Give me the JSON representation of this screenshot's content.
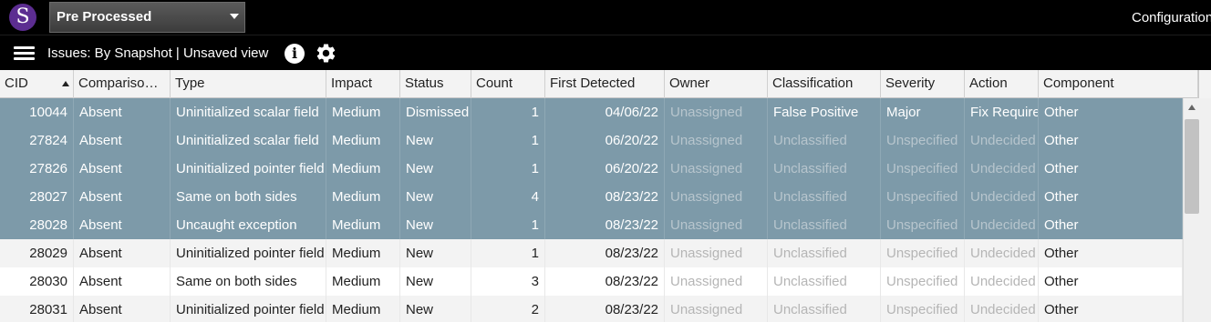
{
  "app": {
    "logo_letter": "S",
    "project": "Pre Processed",
    "configuration_label": "Configuration"
  },
  "viewbar": {
    "title": "Issues: By Snapshot | Unsaved view",
    "info_glyph": "i",
    "icons": [
      "menu-icon",
      "info-icon",
      "gear-icon"
    ]
  },
  "colors": {
    "selected_row": "#7d9aa9",
    "logo": "#5c2d91",
    "dim_text": "#b5b5b5"
  },
  "columns": [
    "CID",
    "Compariso…",
    "Type",
    "Impact",
    "Status",
    "Count",
    "First Detected",
    "Owner",
    "Classification",
    "Severity",
    "Action",
    "Component"
  ],
  "sort": {
    "column": "CID",
    "direction": "ascending"
  },
  "rows": [
    {
      "selected": true,
      "cid": "10044",
      "comparison": "Absent",
      "type": "Uninitialized scalar field",
      "impact": "Medium",
      "status": "Dismissed",
      "count": "1",
      "first_detected": "04/06/22",
      "owner": "Unassigned",
      "classification": "False Positive",
      "severity": "Major",
      "action": "Fix Required",
      "component": "Other"
    },
    {
      "selected": true,
      "cid": "27824",
      "comparison": "Absent",
      "type": "Uninitialized scalar field",
      "impact": "Medium",
      "status": "New",
      "count": "1",
      "first_detected": "06/20/22",
      "owner": "Unassigned",
      "classification": "Unclassified",
      "severity": "Unspecified",
      "action": "Undecided",
      "component": "Other"
    },
    {
      "selected": true,
      "cid": "27826",
      "comparison": "Absent",
      "type": "Uninitialized pointer field",
      "impact": "Medium",
      "status": "New",
      "count": "1",
      "first_detected": "06/20/22",
      "owner": "Unassigned",
      "classification": "Unclassified",
      "severity": "Unspecified",
      "action": "Undecided",
      "component": "Other"
    },
    {
      "selected": true,
      "cid": "28027",
      "comparison": "Absent",
      "type": "Same on both sides",
      "impact": "Medium",
      "status": "New",
      "count": "4",
      "first_detected": "08/23/22",
      "owner": "Unassigned",
      "classification": "Unclassified",
      "severity": "Unspecified",
      "action": "Undecided",
      "component": "Other"
    },
    {
      "selected": true,
      "cid": "28028",
      "comparison": "Absent",
      "type": "Uncaught exception",
      "impact": "Medium",
      "status": "New",
      "count": "1",
      "first_detected": "08/23/22",
      "owner": "Unassigned",
      "classification": "Unclassified",
      "severity": "Unspecified",
      "action": "Undecided",
      "component": "Other"
    },
    {
      "selected": false,
      "cid": "28029",
      "comparison": "Absent",
      "type": "Uninitialized pointer field",
      "impact": "Medium",
      "status": "New",
      "count": "1",
      "first_detected": "08/23/22",
      "owner": "Unassigned",
      "classification": "Unclassified",
      "severity": "Unspecified",
      "action": "Undecided",
      "component": "Other"
    },
    {
      "selected": false,
      "cid": "28030",
      "comparison": "Absent",
      "type": "Same on both sides",
      "impact": "Medium",
      "status": "New",
      "count": "3",
      "first_detected": "08/23/22",
      "owner": "Unassigned",
      "classification": "Unclassified",
      "severity": "Unspecified",
      "action": "Undecided",
      "component": "Other"
    },
    {
      "selected": false,
      "cid": "28031",
      "comparison": "Absent",
      "type": "Uninitialized pointer field",
      "impact": "Medium",
      "status": "New",
      "count": "2",
      "first_detected": "08/23/22",
      "owner": "Unassigned",
      "classification": "Unclassified",
      "severity": "Unspecified",
      "action": "Undecided",
      "component": "Other"
    }
  ]
}
